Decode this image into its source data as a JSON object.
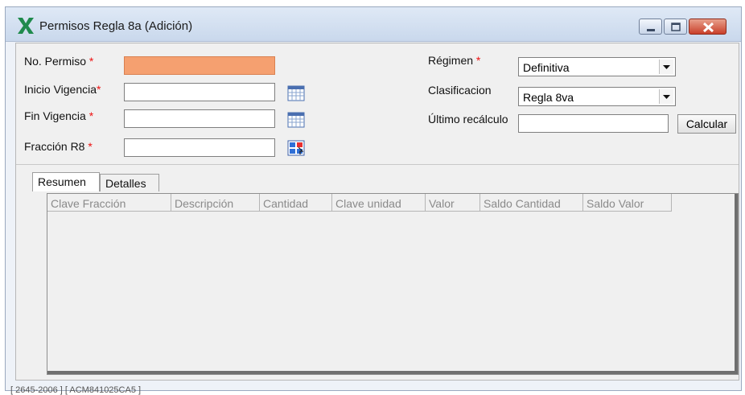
{
  "window": {
    "title": "Permisos Regla 8a (Adición)",
    "controls": {
      "minimize": "minimize",
      "maximize": "maximize",
      "close": "close"
    }
  },
  "form": {
    "no_permiso": {
      "label": "No. Permiso",
      "required": "*",
      "value": ""
    },
    "inicio_vigencia": {
      "label": "Inicio Vigencia",
      "required": "*",
      "value": ""
    },
    "fin_vigencia": {
      "label": "Fin Vigencia",
      "required": "*",
      "value": ""
    },
    "fraccion_r8": {
      "label": "Fracción R8",
      "required": "*",
      "value": ""
    },
    "regimen": {
      "label": "Régimen",
      "required": "*",
      "value": "Definitiva"
    },
    "clasificacion": {
      "label": "Clasificacion",
      "value": "Regla 8va"
    },
    "ultimo_recalculo": {
      "label": "Último recálculo",
      "value": ""
    },
    "calcular_label": "Calcular"
  },
  "tabs": [
    {
      "label": "Resumen",
      "active": true
    },
    {
      "label": "Detalles",
      "active": false
    }
  ],
  "grid": {
    "columns": [
      "Clave Fracción",
      "Descripción",
      "Cantidad",
      "Clave unidad",
      "Valor",
      "Saldo Cantidad",
      "Saldo Valor"
    ],
    "rows": []
  },
  "status_bar": {
    "text": "[ 2645-2006 ]  [ ACM841025CA5 ]"
  },
  "colors": {
    "active_field": "#f5a070",
    "required": "#e11111",
    "titlebar": "#c9d8ec"
  }
}
